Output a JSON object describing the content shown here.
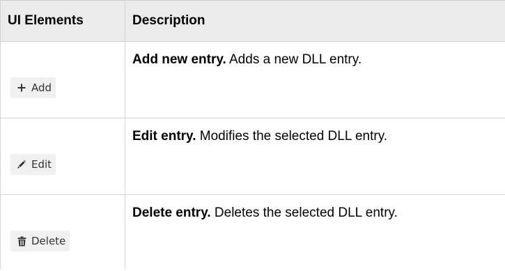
{
  "header": {
    "ui_elements": "UI Elements",
    "description": "Description"
  },
  "rows": [
    {
      "button_label": "Add",
      "icon": "plus-icon",
      "title": "Add new entry.",
      "text": " Adds a new DLL entry."
    },
    {
      "button_label": "Edit",
      "icon": "pencil-icon",
      "title": "Edit entry.",
      "text": " Modifies the selected DLL entry."
    },
    {
      "button_label": "Delete",
      "icon": "trash-icon",
      "title": "Delete entry.",
      "text": " Deletes the selected DLL entry."
    }
  ],
  "colors": {
    "header_bg": "#ebebeb",
    "button_bg": "#f0f0f0",
    "border": "#d4d4d4"
  }
}
